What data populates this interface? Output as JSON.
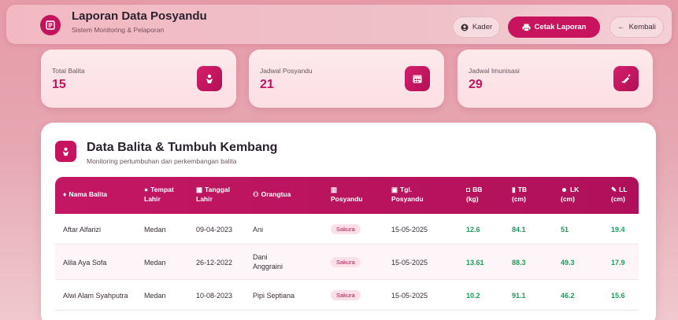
{
  "header": {
    "title": "Laporan Data Posyandu",
    "subtitle": "Sistem Monitoring & Pelaporan",
    "kader_label": "Kader",
    "cetak_label": "Cetak Laporan",
    "kembali_label": "Kembali"
  },
  "stats": [
    {
      "label": "Total Balita",
      "value": "15",
      "icon": "baby-icon"
    },
    {
      "label": "Jadwal Posyandu",
      "value": "21",
      "icon": "calendar-icon"
    },
    {
      "label": "Jadwal Imunisasi",
      "value": "29",
      "icon": "syringe-icon"
    }
  ],
  "panel": {
    "title": "Data Balita & Tumbuh Kembang",
    "subtitle": "Monitoring pertumbuhan dan perkembangan balita"
  },
  "table": {
    "columns": [
      {
        "line1": "Nama Balita",
        "line2": "",
        "icon": "baby-icon"
      },
      {
        "line1": "Tempat",
        "line2": "Lahir",
        "icon": "map-pin-icon"
      },
      {
        "line1": "Tanggal",
        "line2": "Lahir",
        "icon": "calendar-icon"
      },
      {
        "line1": "Orangtua",
        "line2": "",
        "icon": "users-icon"
      },
      {
        "line1": "",
        "line2": "Posyandu",
        "icon": "building-icon"
      },
      {
        "line1": "Tgl.",
        "line2": "Posyandu",
        "icon": "calendar-check-icon"
      },
      {
        "line1": "BB",
        "line2": "(kg)",
        "icon": "weight-icon"
      },
      {
        "line1": "TB",
        "line2": "(cm)",
        "icon": "ruler-icon"
      },
      {
        "line1": "LK",
        "line2": "(cm)",
        "icon": "head-icon"
      },
      {
        "line1": "LL",
        "line2": "(cm)",
        "icon": "pen-icon"
      }
    ],
    "rows": [
      {
        "nama": "Aftar Alfarizi",
        "tempat": "Medan",
        "tgl_lahir": "09-04-2023",
        "orangtua": [
          "Ani"
        ],
        "posyandu": "Sakura",
        "tgl_posyandu": "15-05-2025",
        "bb": "12.6",
        "tb": "84.1",
        "lk": "51",
        "ll": "19.4"
      },
      {
        "nama": "Alila Aya Sofa",
        "tempat": "Medan",
        "tgl_lahir": "26-12-2022",
        "orangtua": [
          "Dani",
          "Anggraini"
        ],
        "posyandu": "Sakura",
        "tgl_posyandu": "15-05-2025",
        "bb": "13.61",
        "tb": "88.3",
        "lk": "49.3",
        "ll": "17.9"
      },
      {
        "nama": "Alwi Alam Syahputra",
        "tempat": "Medan",
        "tgl_lahir": "10-08-2023",
        "orangtua": [
          "Pipi Septiana"
        ],
        "posyandu": "Sakura",
        "tgl_posyandu": "15-05-2025",
        "bb": "10.2",
        "tb": "91.1",
        "lk": "46.2",
        "ll": "15.6"
      }
    ]
  },
  "colors": {
    "accent": "#c8145e",
    "value_green": "#1c9b5a"
  }
}
